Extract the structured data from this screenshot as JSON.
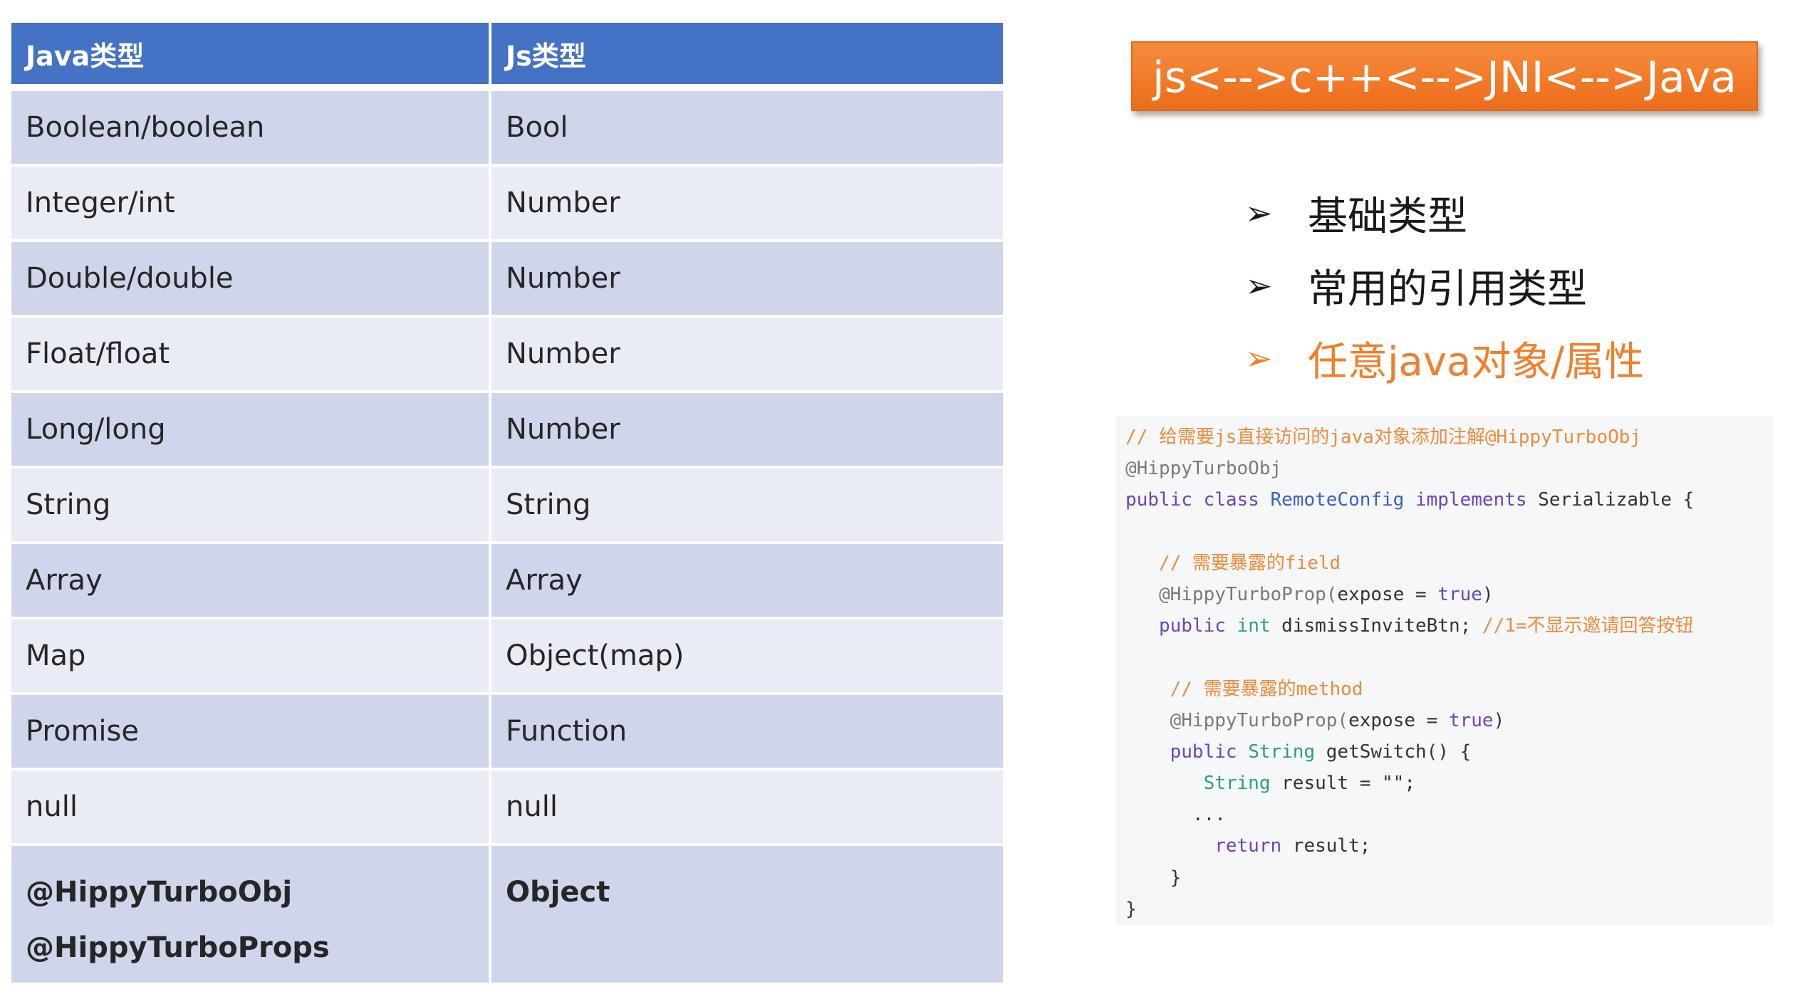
{
  "table": {
    "headers": [
      "Java类型",
      "Js类型"
    ],
    "rows": [
      {
        "java": "Boolean/boolean",
        "js": "Bool"
      },
      {
        "java": "Integer/int",
        "js": "Number"
      },
      {
        "java": "Double/double",
        "js": "Number"
      },
      {
        "java": "Float/float",
        "js": "Number"
      },
      {
        "java": "Long/long",
        "js": "Number"
      },
      {
        "java": "String",
        "js": "String"
      },
      {
        "java": "Array",
        "js": "Array"
      },
      {
        "java": "Map",
        "js": "Object(map)"
      },
      {
        "java": "Promise",
        "js": "Function"
      },
      {
        "java": "null",
        "js": "null"
      }
    ],
    "last_row": {
      "java_line1": "@HippyTurboObj",
      "java_line2": "@HippyTurboProps",
      "js": "Object"
    }
  },
  "banner": {
    "text": "js<-->c++<-->JNI<-->Java"
  },
  "bullets": [
    {
      "arrow": "➢",
      "text": "基础类型"
    },
    {
      "arrow": "➢",
      "text": "常用的引用类型"
    },
    {
      "arrow": "➢",
      "text": "任意java对象/属性"
    }
  ],
  "code": {
    "l01": "// 给需要js直接访问的java对象添加注解@HippyTurboObj",
    "l02": "@HippyTurboObj",
    "l03_kw": "public class ",
    "l03_cls": "RemoteConfig",
    "l03_kw2": " implements ",
    "l03_rest": "Serializable {",
    "l05": "   // 需要暴露的field",
    "l06_annot": "   @HippyTurboProp(",
    "l06_plain": "expose = ",
    "l06_kw": "true",
    "l06_end": ")",
    "l07_kw": "   public ",
    "l07_type": "int",
    "l07_plain": " dismissInviteBtn; ",
    "l07_comment": "//1=不显示邀请回答按钮",
    "l09": "    // 需要暴露的method",
    "l10_annot": "    @HippyTurboProp(",
    "l10_plain": "expose = ",
    "l10_kw": "true",
    "l10_end": ")",
    "l11_kw": "    public ",
    "l11_type": "String",
    "l11_plain": " getSwitch() {",
    "l12_type": "       String",
    "l12_plain": " result = \"\";",
    "l13": "      ...",
    "l14_kw": "        return",
    "l14_plain": " result;",
    "l15": "    }",
    "l16": "}"
  }
}
